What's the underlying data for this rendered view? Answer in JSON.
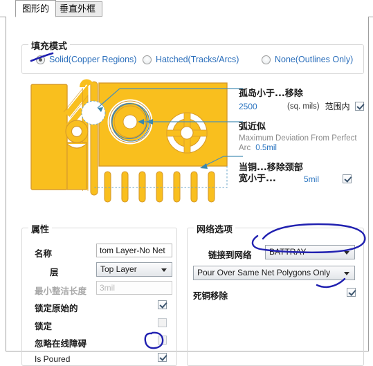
{
  "window": {
    "tabs": [
      {
        "label": "图形的",
        "active": true
      },
      {
        "label": "垂直外框",
        "active": false
      }
    ]
  },
  "fill_mode": {
    "title": "填充模式",
    "options": [
      {
        "label": "Solid(Copper Regions)",
        "selected": true
      },
      {
        "label": "Hatched(Tracks/Arcs)",
        "selected": false
      },
      {
        "label": "None(Outlines Only)",
        "selected": false
      }
    ]
  },
  "callouts": {
    "island": {
      "heading": "孤岛小于...移除",
      "value": "2500",
      "unit": "(sq. mils)",
      "suffix": "范围内",
      "checked": true
    },
    "arc": {
      "heading": "弧近似",
      "sub_line1": "Maximum Deviation From Perfect",
      "sub_line2_label": "Arc",
      "sub_line2_value": "0.5mil"
    },
    "neck": {
      "heading_line1": "当铜...移除颈部",
      "heading_line2": "宽小于...",
      "value": "5mil",
      "checked": true
    }
  },
  "properties": {
    "title": "属性",
    "name_label": "名称",
    "name_value": "tom Layer-No Net",
    "layer_label": "层",
    "layer_value": "Top Layer",
    "min_prim_label": "最小整洁长度",
    "min_prim_placeholder": "3mil",
    "lock_primitives_label": "锁定原始的",
    "lock_primitives_checked": true,
    "locked_label": "锁定",
    "locked_checked": false,
    "ignore_violations_label": "忽略在线障碍",
    "ignore_violations_checked": false,
    "is_poured_label": "Is Poured",
    "is_poured_checked": true
  },
  "net_options": {
    "title": "网络选项",
    "connect_label": "链接到网络",
    "connect_value": "BATTRAY-",
    "pour_mode_value": "Pour Over Same Net Polygons Only",
    "remove_dead_label": "死铜移除",
    "remove_dead_checked": true
  },
  "colors": {
    "copper": "#f9bf1e",
    "copper_edge": "#d79b2b",
    "link_text": "#2a6ebb",
    "callout_line": "#4a90b8",
    "ink": "#2020b0"
  }
}
